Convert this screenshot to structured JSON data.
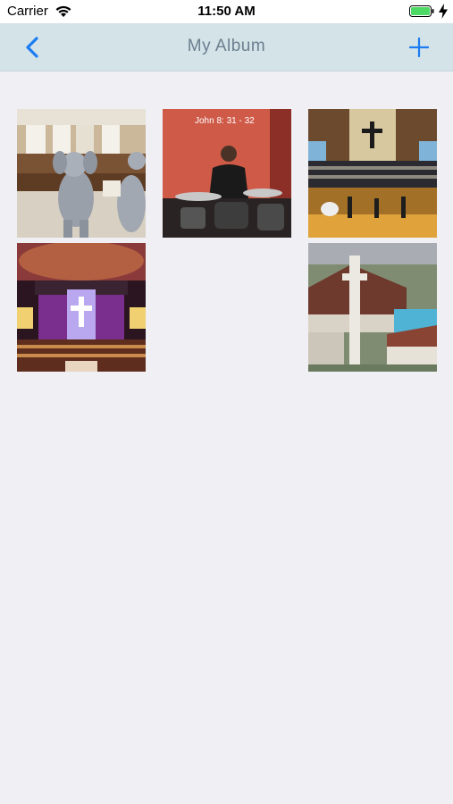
{
  "status_bar": {
    "carrier": "Carrier",
    "time": "11:50 AM",
    "battery_color": "#4cd964"
  },
  "nav": {
    "title": "My Album",
    "back_icon": "chevron-left-icon",
    "add_icon": "plus-icon",
    "accent": "#1e7cf2"
  },
  "photos": [
    {
      "subject": "children in elephant costumes",
      "caption": ""
    },
    {
      "subject": "drummer on stage",
      "caption": "John 8: 31 - 32"
    },
    {
      "subject": "choir in church sanctuary",
      "caption": ""
    },
    {
      "subject": "church interior with purple lighting",
      "caption": ""
    },
    {
      "subject": "aerial view of church building",
      "caption": ""
    }
  ]
}
